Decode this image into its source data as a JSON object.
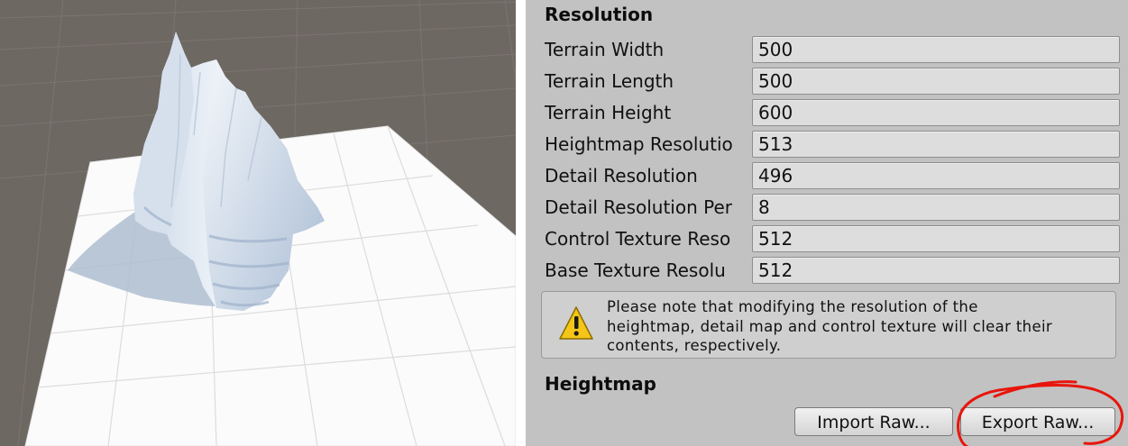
{
  "resolution": {
    "title": "Resolution",
    "fields": [
      {
        "label": "Terrain Width",
        "value": "500"
      },
      {
        "label": "Terrain Length",
        "value": "500"
      },
      {
        "label": "Terrain Height",
        "value": "600"
      },
      {
        "label": "Heightmap Resolutio",
        "value": "513"
      },
      {
        "label": "Detail Resolution",
        "value": "496"
      },
      {
        "label": "Detail Resolution Per",
        "value": "8"
      },
      {
        "label": "Control Texture Reso",
        "value": "512"
      },
      {
        "label": "Base Texture Resolu",
        "value": "512"
      }
    ],
    "help_lines": [
      "Please note that modifying the resolution of the",
      "heightmap, detail map and control texture will clear their",
      "contents, respectively."
    ]
  },
  "heightmap": {
    "title": "Heightmap",
    "import_label": "Import Raw...",
    "export_label": "Export Raw..."
  },
  "colors": {
    "inspector_bg": "#c2c2c2",
    "scene_bg": "#6e6863",
    "warning": "#f5c518",
    "annotation": "#e8150d"
  }
}
